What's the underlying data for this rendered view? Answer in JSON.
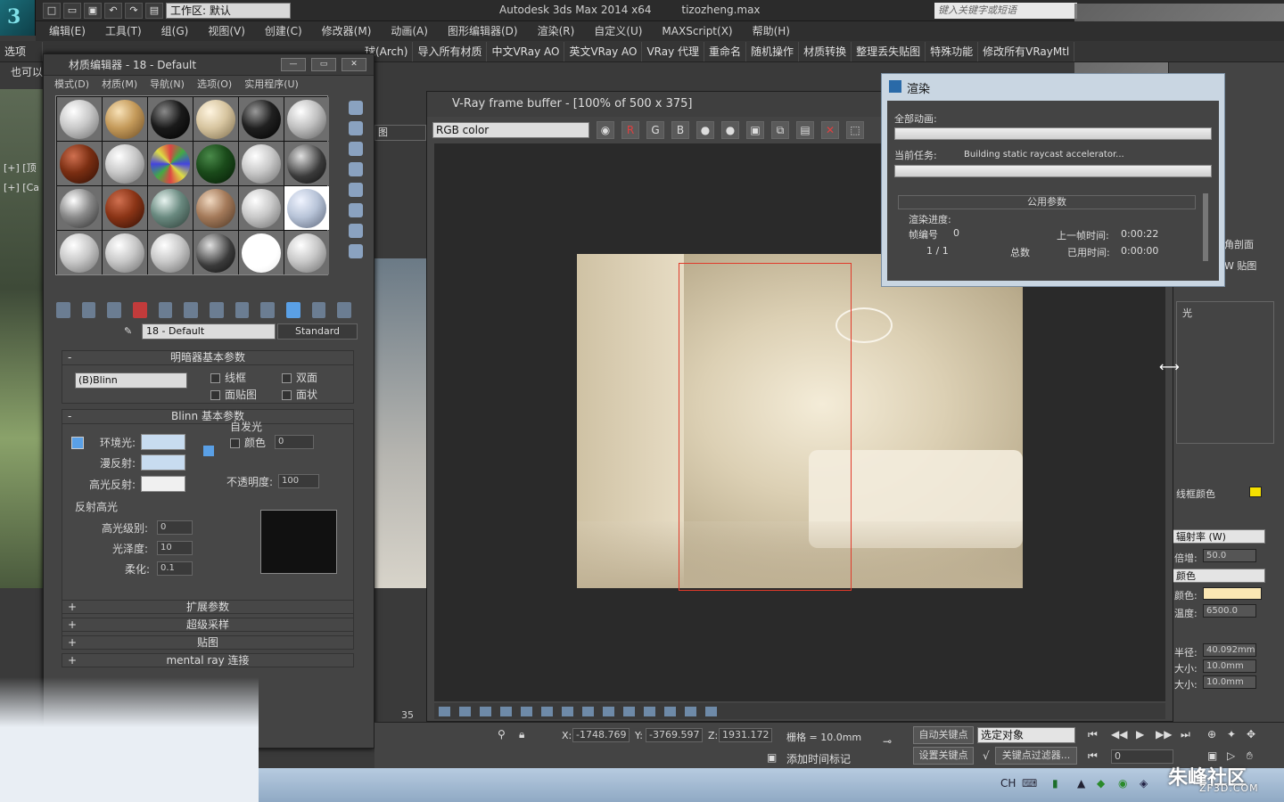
{
  "app": {
    "title": "Autodesk 3ds Max  2014 x64",
    "file": "tizozheng.max",
    "workspace": "工作区: 默认",
    "search_placeholder": "键入关键字或短语"
  },
  "menu": [
    "编辑(E)",
    "工具(T)",
    "组(G)",
    "视图(V)",
    "创建(C)",
    "修改器(M)",
    "动画(A)",
    "图形编辑器(D)",
    "渲染(R)",
    "自定义(U)",
    "MAXScript(X)",
    "帮助(H)"
  ],
  "plugin_toolbar": {
    "left_labels": [
      "选项",
      "也可以"
    ],
    "buttons": [
      "球(Arch)",
      "导入所有材质",
      "中文VRay AO",
      "英文VRay AO",
      "VRay 代理",
      "重命名",
      "随机操作",
      "材质转换",
      "整理丢失贴图",
      "特殊功能",
      "修改所有VRayMtl"
    ]
  },
  "viewport": {
    "label1": "[+] [顶",
    "label2": "[+] [Ca",
    "dropdown": "图",
    "frame_number": "35"
  },
  "material_editor": {
    "title": "材质编辑器 - 18 - Default",
    "menu": [
      "模式(D)",
      "材质(M)",
      "导航(N)",
      "选项(O)",
      "实用程序(U)"
    ],
    "material_name": "18 - Default",
    "material_type": "Standard",
    "shader_rollout": {
      "title": "明暗器基本参数",
      "shader": "(B)Blinn",
      "options": [
        "线框",
        "双面",
        "面贴图",
        "面状"
      ]
    },
    "blinn_rollout": {
      "title": "Blinn 基本参数",
      "self_illum_label": "自发光",
      "color_label": "颜色",
      "color_value": "0",
      "ambient_label": "环境光:",
      "diffuse_label": "漫反射:",
      "specular_label": "高光反射:",
      "opacity_label": "不透明度:",
      "opacity_value": "100",
      "specular_group": "反射高光",
      "spec_level_label": "高光级别:",
      "spec_level_value": "0",
      "gloss_label": "光泽度:",
      "gloss_value": "10",
      "soften_label": "柔化:",
      "soften_value": "0.1"
    },
    "collapsed_rollouts": [
      "扩展参数",
      "超级采样",
      "贴图",
      "mental ray 连接"
    ],
    "swatch_colors": {
      "ambient": "#c8dcf0",
      "diffuse": "#c8dcf0",
      "specular": "#f0f0f0",
      "highlight_preview": "#111111"
    }
  },
  "vfb": {
    "title": "V-Ray frame buffer - [100% of 500 x 375]",
    "channel": "RGB color",
    "channel_buttons": [
      "R",
      "G",
      "B"
    ]
  },
  "render_dialog": {
    "title": "渲染",
    "total_anim_label": "全部动画:",
    "current_task_label": "当前任务:",
    "current_task": "Building static raycast accelerator...",
    "common_params": "公用参数",
    "progress_label": "渲染进度:",
    "frame_label": "帧编号",
    "frame_value": "0",
    "frame_count": "1  /  1",
    "total_label": "总数",
    "last_frame_label": "上一帧时间:",
    "last_frame_value": "0:00:22",
    "elapsed_label": "已用时间:",
    "elapsed_value": "0:00:00"
  },
  "command_panel": {
    "labels": [
      "角剖面",
      "W 贴图",
      "光",
      "线框颜色",
      "辐射率 (W)",
      "倍增:",
      "颜色",
      "颜色:",
      "温度:",
      "半径:",
      "大小:",
      "大小:"
    ],
    "multiplier": "50.0",
    "temperature": "6500.0",
    "radius": "40.092mm",
    "size1": "10.0mm",
    "size2": "10.0mm",
    "wire_color": "#f5e000",
    "light_color": "#fbe7b3"
  },
  "status_bar": {
    "x_label": "X:",
    "x_value": "-1748.769",
    "y_label": "Y:",
    "y_value": "-3769.597",
    "z_label": "Z:",
    "z_value": "1931.172",
    "grid": "栅格 = 10.0mm",
    "auto_key": "自动关键点",
    "set_key": "设置关键点",
    "selection": "选定对象",
    "key_filters": "关键点过滤器...",
    "add_time_tag": "添加时间标记",
    "frame_field": "0"
  },
  "taskbar": {
    "ime": "CH",
    "watermark": "朱峰社区",
    "watermark_sub": "ZF3D.COM"
  }
}
